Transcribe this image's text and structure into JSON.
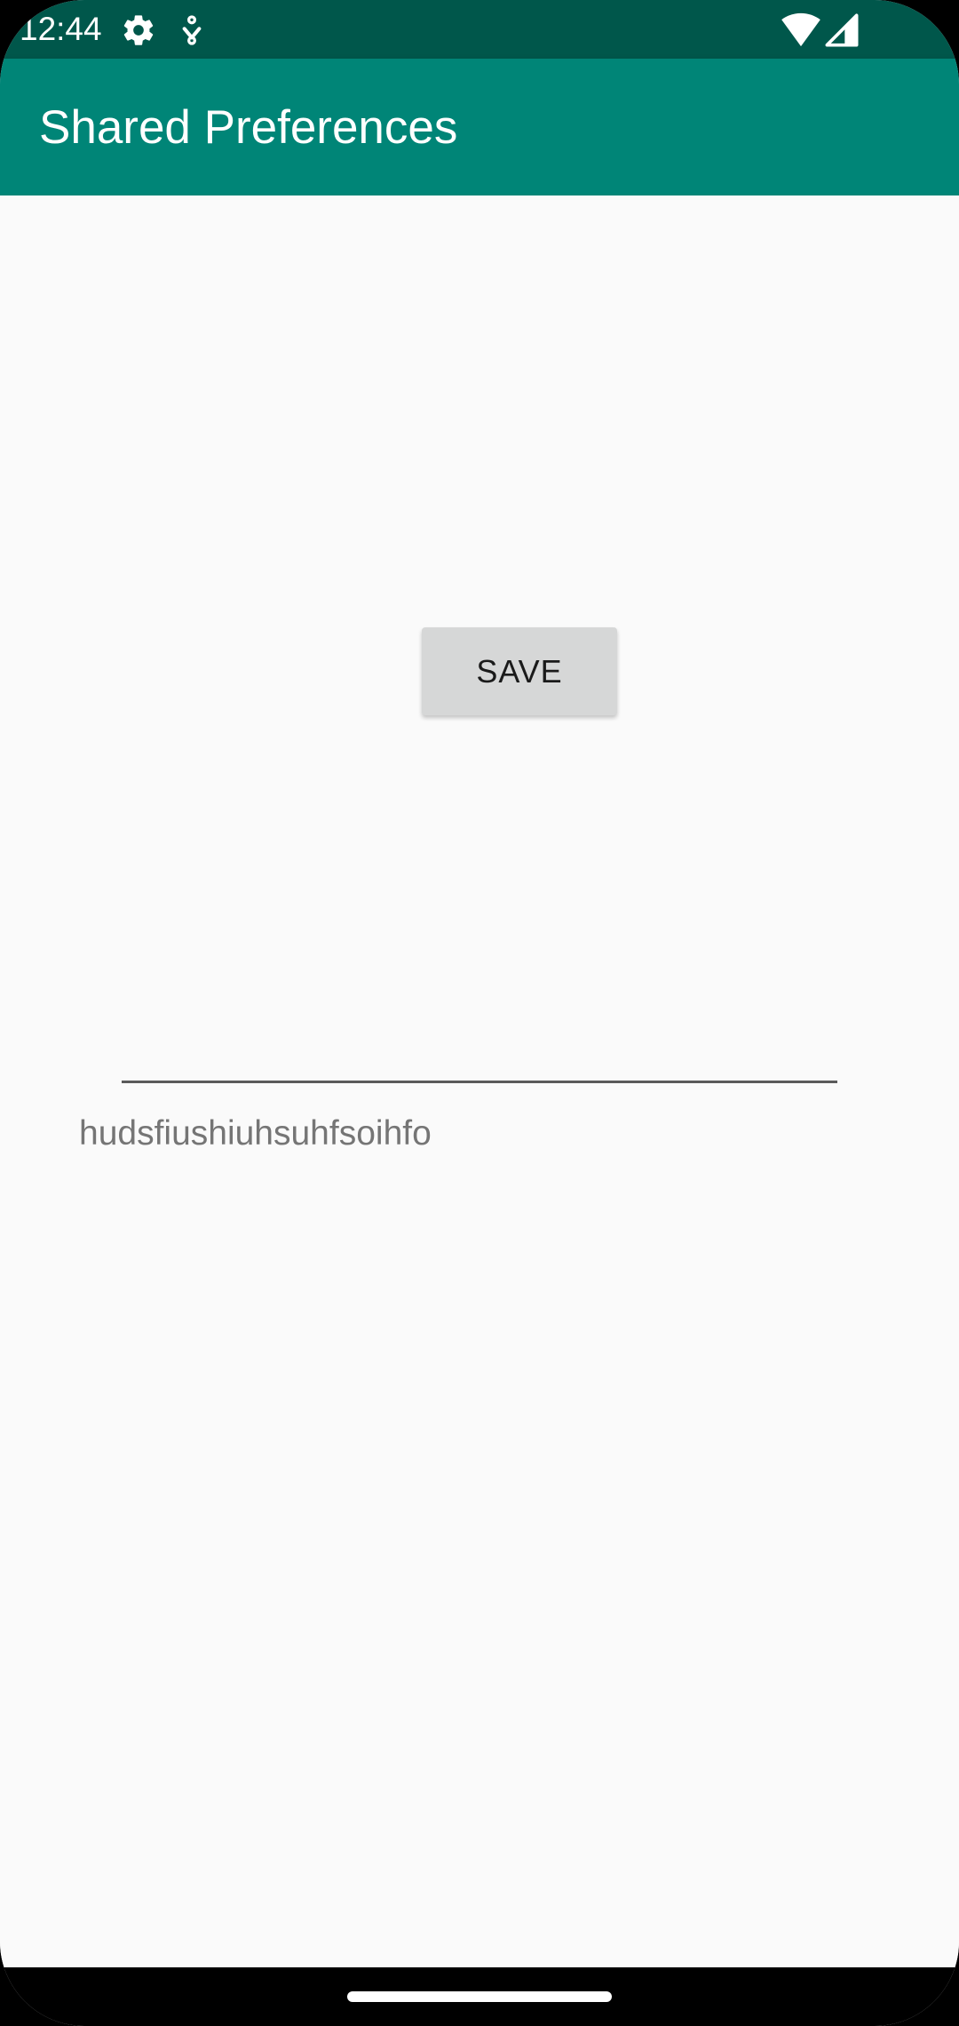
{
  "status_bar": {
    "time": "12:44",
    "icons": [
      "gear-icon",
      "download-icon",
      "wifi-icon",
      "signal-icon"
    ],
    "color": "#00574b"
  },
  "app_bar": {
    "title": "Shared Preferences",
    "color": "#008577"
  },
  "main": {
    "save_label": "SAVE",
    "input_value": "",
    "saved_text": "hudsfiushiuhsuhfsoihfo"
  }
}
